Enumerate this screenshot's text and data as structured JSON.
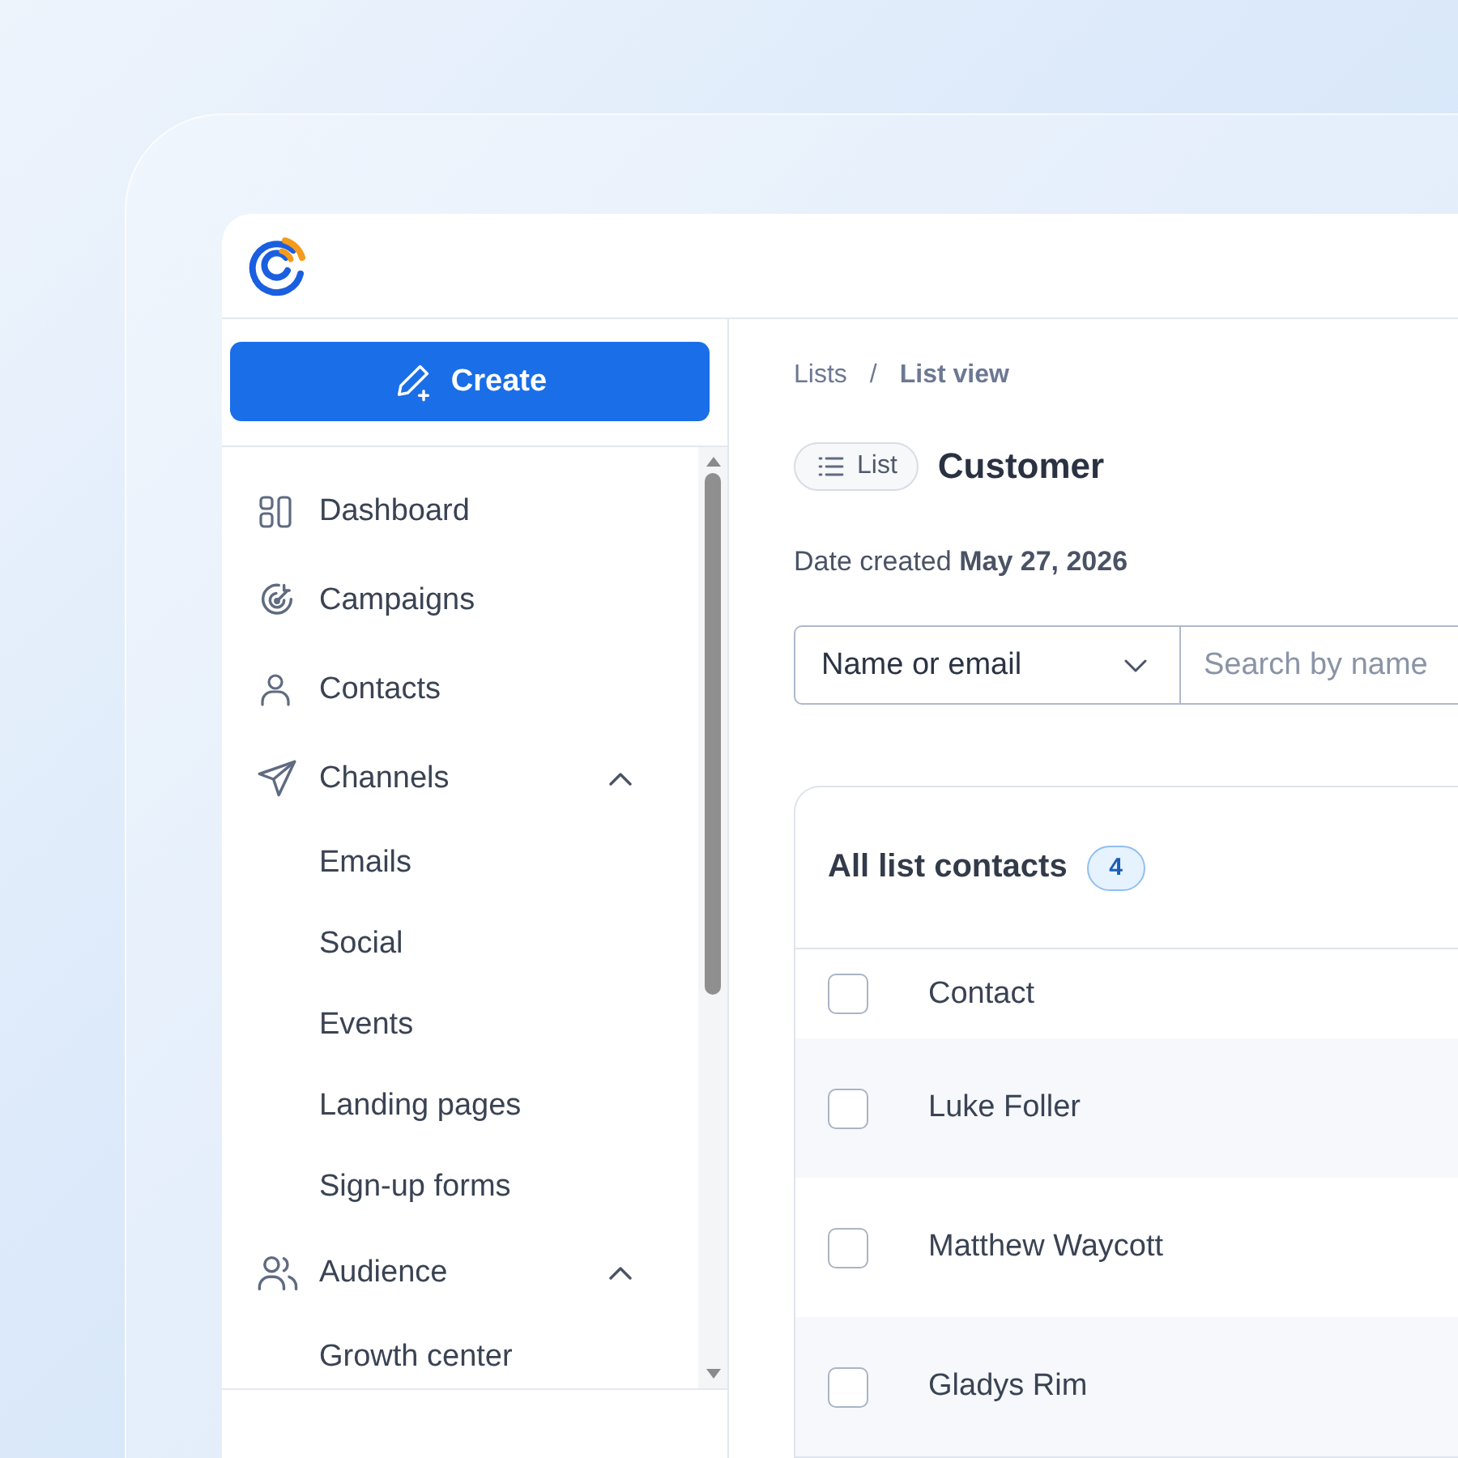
{
  "create_button": {
    "label": "Create"
  },
  "nav": [
    {
      "label": "Dashboard"
    },
    {
      "label": "Campaigns"
    },
    {
      "label": "Contacts"
    },
    {
      "label": "Channels",
      "expanded": true,
      "children": [
        {
          "label": "Emails"
        },
        {
          "label": "Social"
        },
        {
          "label": "Events"
        },
        {
          "label": "Landing pages"
        },
        {
          "label": "Sign-up forms"
        }
      ]
    },
    {
      "label": "Audience",
      "expanded": true,
      "children": [
        {
          "label": "Growth center"
        }
      ]
    }
  ],
  "breadcrumb": {
    "items": [
      "Lists",
      "List view"
    ],
    "separator": "/"
  },
  "header": {
    "type_chip": "List",
    "title": "Customer"
  },
  "date_created": {
    "label": "Date created",
    "value": "May 27, 2026"
  },
  "search": {
    "field_select": "Name or email",
    "placeholder": "Search by name"
  },
  "contacts_card": {
    "title": "All list contacts",
    "count": "4",
    "columns": [
      "Contact"
    ],
    "header_checked": false,
    "rows": [
      {
        "name": "Luke Foller",
        "checked": false
      },
      {
        "name": "Matthew Waycott",
        "checked": false
      },
      {
        "name": "Gladys Rim",
        "checked": false
      }
    ]
  }
}
